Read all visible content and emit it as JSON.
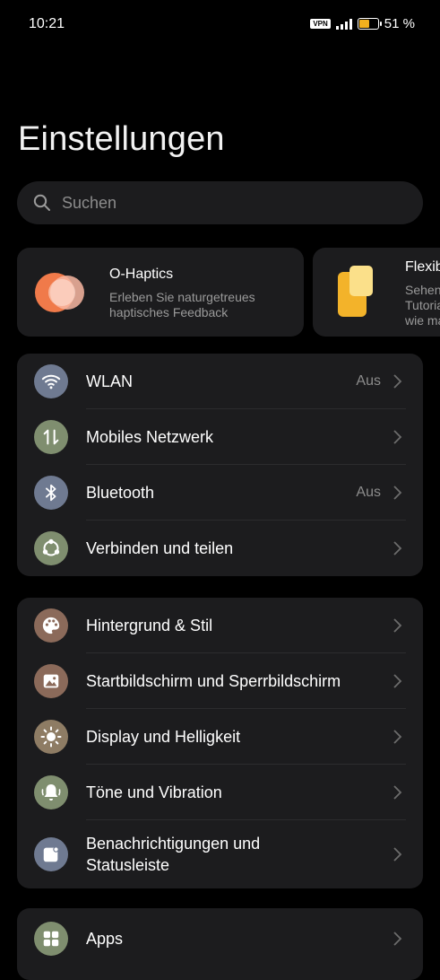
{
  "status": {
    "time": "10:21",
    "vpn": "VPN",
    "battery": "51 %"
  },
  "page": {
    "title": "Einstellungen"
  },
  "search": {
    "placeholder": "Suchen"
  },
  "cards": [
    {
      "title": "O-Haptics",
      "subtitle_line1": "Erleben Sie naturgetreues",
      "subtitle_line2": "haptisches Feedback"
    },
    {
      "title": "Flexib",
      "subtitle_line1": "Sehen",
      "subtitle_line2": "Tutoria",
      "subtitle_line3": "wie ma"
    }
  ],
  "groups": {
    "connectivity": [
      {
        "label": "WLAN",
        "value": "Aus",
        "icon": "wifi-icon",
        "color": "#6f7a91"
      },
      {
        "label": "Mobiles Netzwerk",
        "value": "",
        "icon": "mobile-data-icon",
        "color": "#7f8e6f"
      },
      {
        "label": "Bluetooth",
        "value": "Aus",
        "icon": "bluetooth-icon",
        "color": "#6f7a91"
      },
      {
        "label": "Verbinden und teilen",
        "value": "",
        "icon": "share-icon",
        "color": "#7f8e6f"
      }
    ],
    "display": [
      {
        "label": "Hintergrund & Stil",
        "icon": "palette-icon",
        "color": "#8b6a5a"
      },
      {
        "label": "Startbildschirm und Sperrbildschirm",
        "icon": "image-icon",
        "color": "#8b6a5a"
      },
      {
        "label": "Display und Helligkeit",
        "icon": "brightness-icon",
        "color": "#8e7c64"
      },
      {
        "label": "Töne und Vibration",
        "icon": "bell-icon",
        "color": "#7f8e6f"
      },
      {
        "label_line1": "Benachrichtigungen und",
        "label_line2": "Statusleiste",
        "icon": "notification-icon",
        "color": "#6f7a91"
      }
    ],
    "apps": [
      {
        "label": "Apps",
        "icon": "apps-icon",
        "color": "#7f8e6f"
      }
    ]
  }
}
